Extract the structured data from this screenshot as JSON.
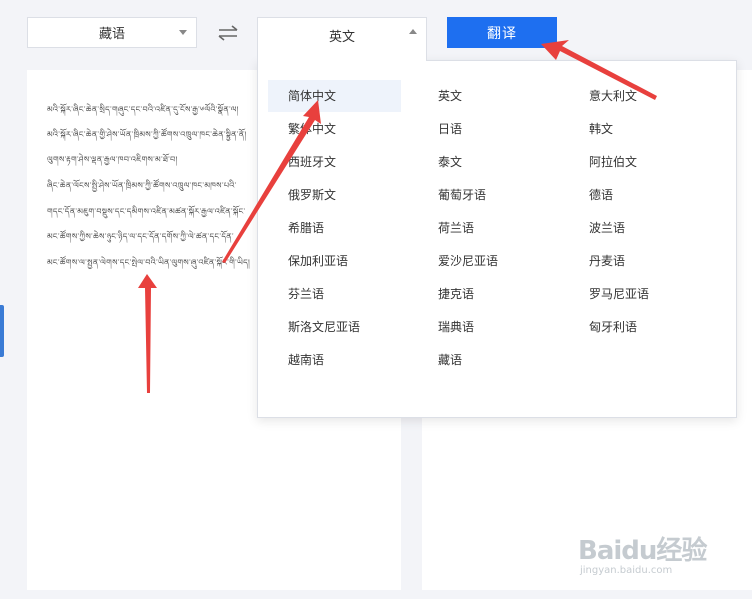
{
  "source_lang": {
    "value": "藏语"
  },
  "target_lang": {
    "value": "英文"
  },
  "translate_button": {
    "label": "翻译"
  },
  "source_text": {
    "lines": [
      "མའི་སྐོར་ཞིང་ཆེན་སྲིད་གཞུང་དང་བའི་འཛིན་དུ་ངོས་རྒྱ་༦ལོའི་སྣོན་ལ།",
      "མའི་སྐོར་ཞིང་ཆེན་གྱི་ཤེས་ཡོན་ཁྲིམས་ཀྱི་ཚོགས་འཁྲུལ་ཁང་ཆེན་སྟྱིན་ནོ།",
      "ལུགས་རྟག་ཤེས་ལྡན་རྒྱལ་ཁབ་འཇིགས་མ་ཐོ་བ།",
      "ཞིང་ཆེན་ལོངས་སྤྱི་ཤེས་ཡོན་ཁྲིམས་ཀྱི་ཚོགས་འཁྲུལ་ཁང་མཁས་པའི་",
      "གདང་དོན་མཇུག་བསྡུས་དང་དམིགས་འཛིན་མཚན་སྐོར་རྒྱལ་འཛིན་སྐོང་",
      "མང་ཚོགས་ཀྱིས་ཆེས་ཉུང་ཉིད་ལ་དང་དོན་དགོས་ཀྱི་ལེ་ཚན་དང་དོན་",
      "མང་ཚོགས་ལ་སྤྱན་ལེགས་དང་སྤེལ་བའི་ཡིན་ལུགས་ཞུ་འཛིན་སྐོང་གི་ཡིད།"
    ]
  },
  "language_options": [
    [
      "简体中文",
      "英文",
      "意大利文"
    ],
    [
      "繁体中文",
      "日语",
      "韩文"
    ],
    [
      "西班牙文",
      "泰文",
      "阿拉伯文"
    ],
    [
      "俄罗斯文",
      "葡萄牙语",
      "德语"
    ],
    [
      "希腊语",
      "荷兰语",
      "波兰语"
    ],
    [
      "保加利亚语",
      "爱沙尼亚语",
      "丹麦语"
    ],
    [
      "芬兰语",
      "捷克语",
      "罗马尼亚语"
    ],
    [
      "斯洛文尼亚语",
      "瑞典语",
      "匈牙利语"
    ],
    [
      "越南语",
      "藏语",
      ""
    ]
  ],
  "selected_option": "简体中文",
  "watermark": {
    "logo": "Baidu经验",
    "url": "jingyan.baidu.com"
  },
  "colors": {
    "accent": "#1e6ff0",
    "arrow": "#e8403d",
    "selected_bg": "#eef3fb"
  }
}
